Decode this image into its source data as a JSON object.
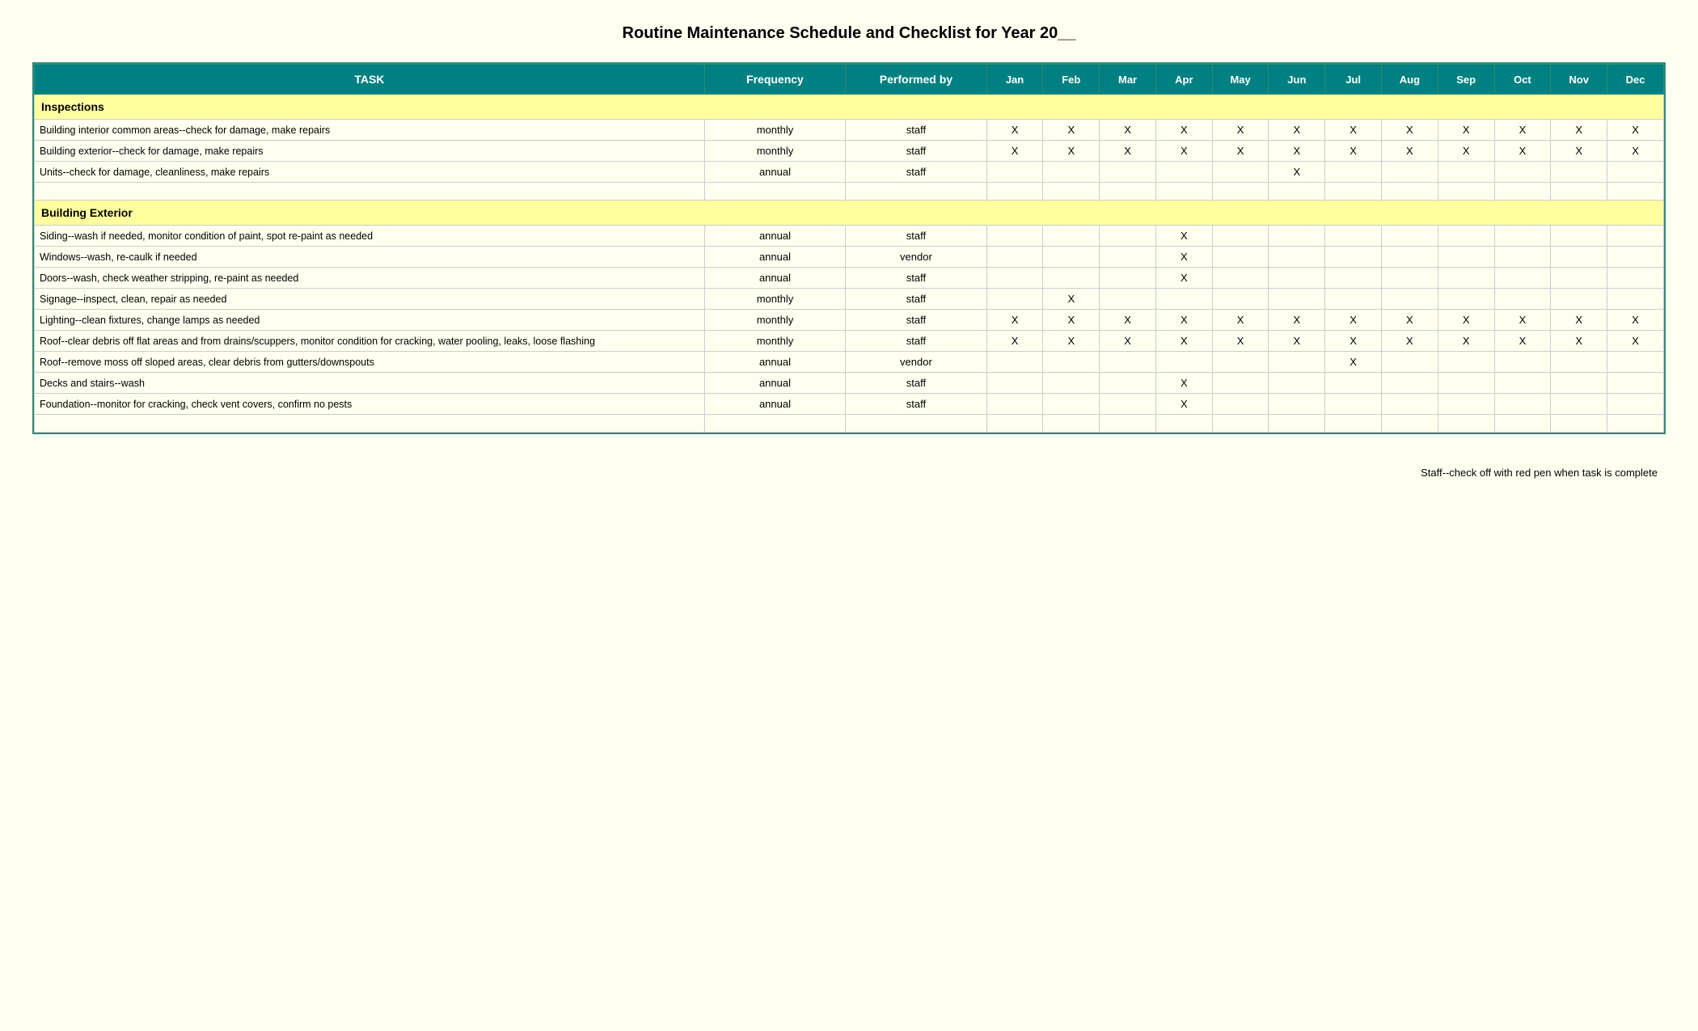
{
  "title": "Routine Maintenance Schedule and Checklist for Year 20__",
  "header": {
    "task": "TASK",
    "frequency": "Frequency",
    "performed_by": "Performed by",
    "months": [
      "Jan",
      "Feb",
      "Mar",
      "Apr",
      "May",
      "Jun",
      "Jul",
      "Aug",
      "Sep",
      "Oct",
      "Nov",
      "Dec"
    ]
  },
  "sections": [
    {
      "name": "Inspections",
      "rows": [
        {
          "task": "Building interior common areas--check for damage, make repairs",
          "frequency": "monthly",
          "performed_by": "staff",
          "months": [
            "X",
            "X",
            "X",
            "X",
            "X",
            "X",
            "X",
            "X",
            "X",
            "X",
            "X",
            "X"
          ]
        },
        {
          "task": "Building exterior--check for damage, make repairs",
          "frequency": "monthly",
          "performed_by": "staff",
          "months": [
            "X",
            "X",
            "X",
            "X",
            "X",
            "X",
            "X",
            "X",
            "X",
            "X",
            "X",
            "X"
          ]
        },
        {
          "task": "Units--check for damage, cleanliness, make repairs",
          "frequency": "annual",
          "performed_by": "staff",
          "months": [
            "",
            "",
            "",
            "",
            "",
            "X",
            "",
            "",
            "",
            "",
            "",
            ""
          ]
        },
        {
          "task": "",
          "frequency": "",
          "performed_by": "",
          "months": [
            "",
            "",
            "",
            "",
            "",
            "",
            "",
            "",
            "",
            "",
            "",
            ""
          ]
        }
      ]
    },
    {
      "name": "Building Exterior",
      "rows": [
        {
          "task": "Siding--wash if needed, monitor condition of paint, spot re-paint as needed",
          "frequency": "annual",
          "performed_by": "staff",
          "months": [
            "",
            "",
            "",
            "X",
            "",
            "",
            "",
            "",
            "",
            "",
            "",
            ""
          ]
        },
        {
          "task": "Windows--wash, re-caulk if needed",
          "frequency": "annual",
          "performed_by": "vendor",
          "months": [
            "",
            "",
            "",
            "X",
            "",
            "",
            "",
            "",
            "",
            "",
            "",
            ""
          ]
        },
        {
          "task": "Doors--wash, check weather stripping, re-paint as needed",
          "frequency": "annual",
          "performed_by": "staff",
          "months": [
            "",
            "",
            "",
            "X",
            "",
            "",
            "",
            "",
            "",
            "",
            "",
            ""
          ]
        },
        {
          "task": "Signage--inspect, clean, repair as needed",
          "frequency": "monthly",
          "performed_by": "staff",
          "months": [
            "",
            "X",
            "",
            "",
            "",
            "",
            "",
            "",
            "",
            "",
            "",
            ""
          ]
        },
        {
          "task": "Lighting--clean fixtures, change lamps as needed",
          "frequency": "monthly",
          "performed_by": "staff",
          "months": [
            "X",
            "X",
            "X",
            "X",
            "X",
            "X",
            "X",
            "X",
            "X",
            "X",
            "X",
            "X"
          ]
        },
        {
          "task": "Roof--clear debris off flat areas and from drains/scuppers, monitor condition for cracking, water pooling, leaks, loose flashing",
          "frequency": "monthly",
          "performed_by": "staff",
          "months": [
            "X",
            "X",
            "X",
            "X",
            "X",
            "X",
            "X",
            "X",
            "X",
            "X",
            "X",
            "X"
          ]
        },
        {
          "task": "Roof--remove moss off sloped areas, clear debris from gutters/downspouts",
          "frequency": "annual",
          "performed_by": "vendor",
          "months": [
            "",
            "",
            "",
            "",
            "",
            "",
            "X",
            "",
            "",
            "",
            "",
            ""
          ]
        },
        {
          "task": "Decks and stairs--wash",
          "frequency": "annual",
          "performed_by": "staff",
          "months": [
            "",
            "",
            "",
            "X",
            "",
            "",
            "",
            "",
            "",
            "",
            "",
            ""
          ]
        },
        {
          "task": "Foundation--monitor for cracking, check vent covers, confirm no pests",
          "frequency": "annual",
          "performed_by": "staff",
          "months": [
            "",
            "",
            "",
            "X",
            "",
            "",
            "",
            "",
            "",
            "",
            "",
            ""
          ]
        },
        {
          "task": "",
          "frequency": "",
          "performed_by": "",
          "months": [
            "",
            "",
            "",
            "",
            "",
            "",
            "",
            "",
            "",
            "",
            "",
            ""
          ]
        }
      ]
    }
  ],
  "footer_note": "Staff--check off with red pen when task is complete"
}
